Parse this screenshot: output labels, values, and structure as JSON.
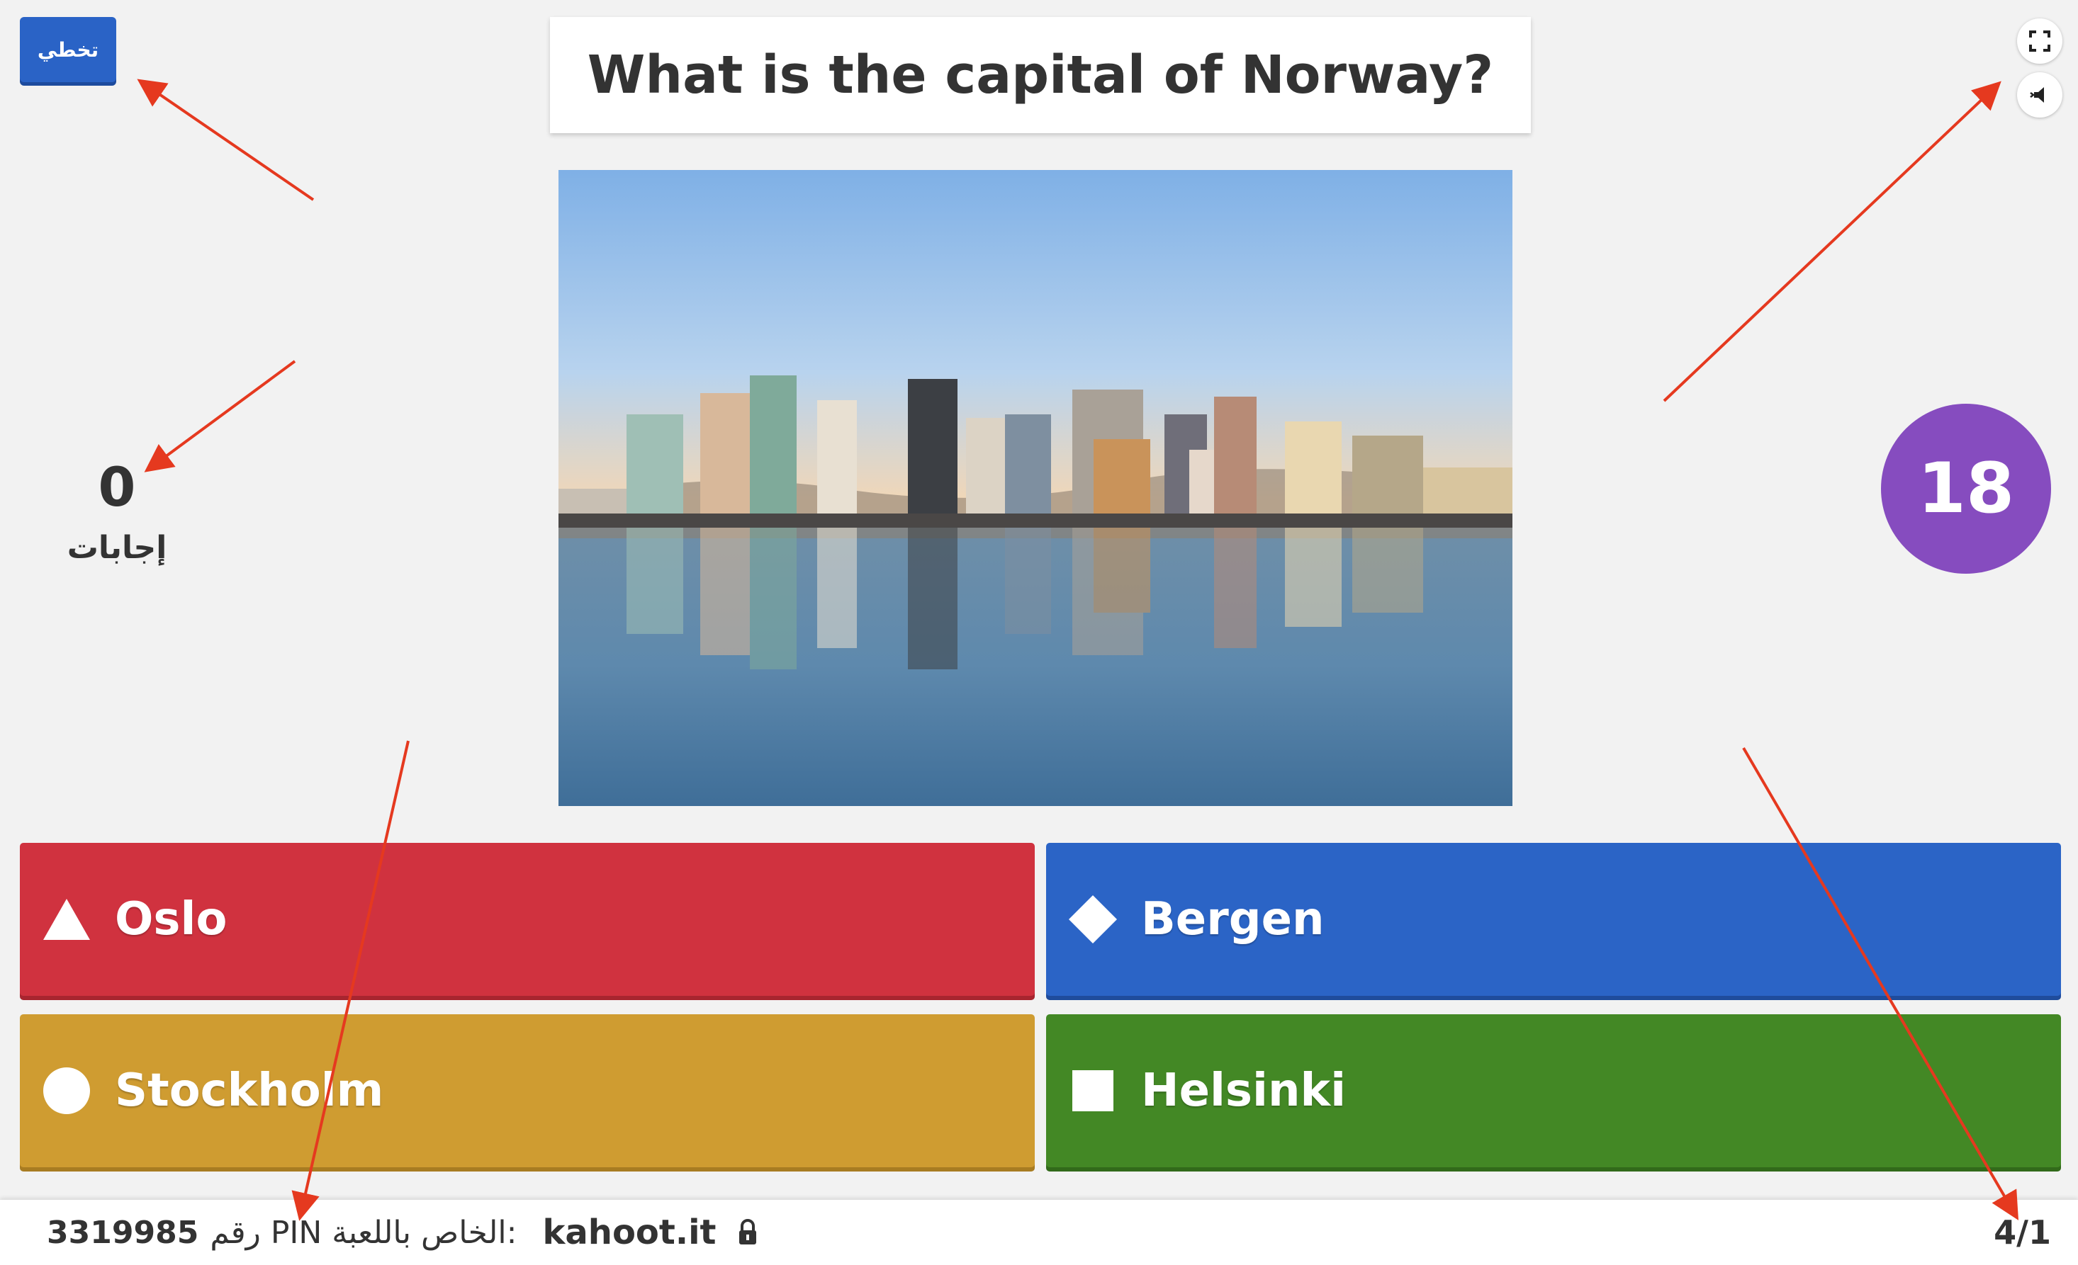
{
  "header": {
    "skip_label": "تخطي",
    "question": "What is the capital of Norway?"
  },
  "controls": {
    "fullscreen_icon": "fullscreen-icon",
    "sound_icon": "sound-icon"
  },
  "media": {
    "description_icon": "city-skyline-image"
  },
  "stats": {
    "answers_count": "0",
    "answers_label": "إجابات"
  },
  "timer": {
    "value": "18"
  },
  "answers": [
    {
      "label": "Oslo",
      "shape": "triangle",
      "color": "#d0323f"
    },
    {
      "label": "Bergen",
      "shape": "diamond",
      "color": "#2b64c6"
    },
    {
      "label": "Stockholm",
      "shape": "circle",
      "color": "#cf9c31"
    },
    {
      "label": "Helsinki",
      "shape": "square",
      "color": "#438825"
    }
  ],
  "footer": {
    "site": "kahoot.it",
    "pin_label": "رقم PIN الخاص باللعبة:",
    "pin_value": "3319985",
    "progress": "4/1",
    "lock_icon": "lock-icon"
  },
  "colors": {
    "background": "#f2f2f2",
    "timer": "#864cbf",
    "annotation_arrow": "#e5391f"
  }
}
